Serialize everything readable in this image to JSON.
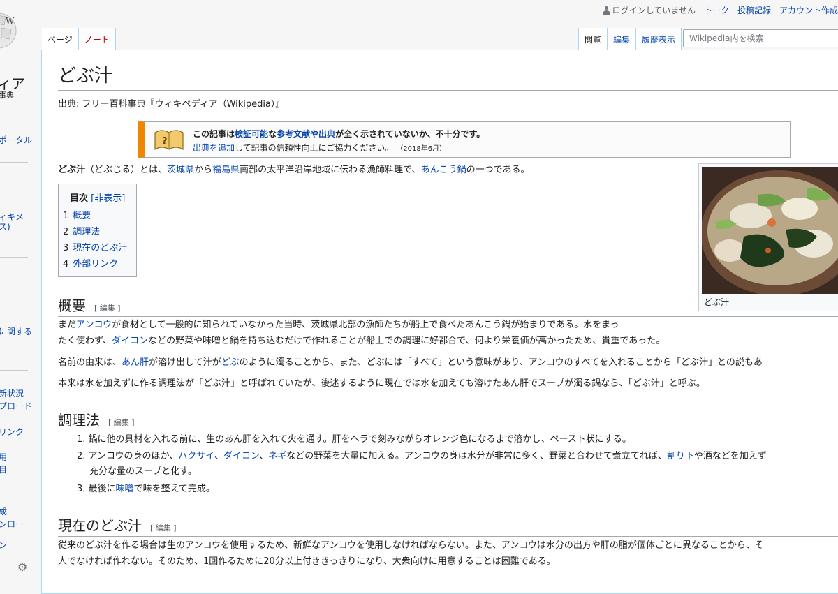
{
  "sidebar": {
    "logo_text": "ィア",
    "logo_sub": "事典",
    "links": [
      "ポータル",
      "ィキメ",
      "ス)",
      "に関する",
      "新状況",
      "プロード",
      "リンク",
      "用",
      "目",
      "成",
      "ンロー",
      "ン"
    ]
  },
  "header": {
    "user_status": "ログインしていません",
    "talk": "トーク",
    "contributions": "投稿記録",
    "create_account": "アカウント作成"
  },
  "tabs": {
    "page": "ページ",
    "notes": "ノート",
    "read": "閲覧",
    "edit": "編集",
    "history": "履歴表示"
  },
  "search": {
    "placeholder": "Wikipedia内を検索"
  },
  "article": {
    "title": "どぶ汁",
    "site_sub": "出典: フリー百科事典『ウィキペディア（Wikipedia）』",
    "ambox": {
      "line1_a": "この記事は",
      "line1_link1": "検証可能",
      "line1_b": "な",
      "line1_link2": "参考文献や出典",
      "line1_c": "が全く示されていないか、不十分です。",
      "line2_link": "出典を追加",
      "line2_text": "して記事の信頼性向上にご協力ください。",
      "date": "（2018年6月）"
    },
    "intro": {
      "bold": "どぶ汁",
      "t1": "（どぶじる）とは、",
      "l1": "茨城県",
      "t2": "から",
      "l2": "福島県",
      "t3": "南部の太平洋沿岸地域に伝わる漁師料理で、",
      "l3": "あんこう鍋",
      "t4": "の一つである。"
    },
    "toc": {
      "title": "目次",
      "toggle": "[非表示]",
      "items": [
        {
          "num": "1",
          "label": "概要"
        },
        {
          "num": "2",
          "label": "調理法"
        },
        {
          "num": "3",
          "label": "現在のどぶ汁"
        },
        {
          "num": "4",
          "label": "外部リンク"
        }
      ]
    },
    "thumb_caption": "どぶ汁",
    "edit_label": "[ 編集 ]",
    "sections": {
      "overview": {
        "title": "概要",
        "p1_a": "まだ",
        "p1_l1": "アンコウ",
        "p1_b": "が食材として一般的に知られていなかった当時、茨城県北部の漁師たちが船上で食べたあんこう鍋が始まりである。水をまっ",
        "p1_c": "たく使わず、",
        "p1_l2": "ダイコン",
        "p1_d": "などの野菜や味噌と鍋を持ち込むだけで作れることが船上での調理に好都合で、何より栄養価が高かったため、貴重であった。",
        "p2_a": "名前の由来は、",
        "p2_l1": "あん肝",
        "p2_b": "が溶け出して汁が",
        "p2_l2": "どぶ",
        "p2_c": "のように濁ることから、また、どぶには「すべて」という意味があり、アンコウのすべてを入れることから「どぶ汁」との説もあ",
        "p3": "本来は水を加えずに作る調理法が「どぶ汁」と呼ばれていたが、後述するように現在では水を加えても溶けたあん肝でスープが濁る鍋なら、「どぶ汁」と呼ぶ。"
      },
      "cooking": {
        "title": "調理法",
        "s1": "1. 鍋に他の具材を入れる前に、生のあん肝を入れて火を通す。肝をヘラで刻みながらオレンジ色になるまで溶かし、ペースト状にする。",
        "s2_a": "2. アンコウの身のほか、",
        "s2_l1": "ハクサイ",
        "s2_b": "、",
        "s2_l2": "ダイコン",
        "s2_c": "、",
        "s2_l3": "ネギ",
        "s2_d": "などの野菜を大量に加える。アンコウの身は水分が非常に多く、野菜と合わせて煮立てれば、",
        "s2_l4": "割り下",
        "s2_e": "や酒などを加えず",
        "s2_f": "充分な量のスープと化す。",
        "s3_a": "3. 最後に",
        "s3_l1": "味噌",
        "s3_b": "で味を整えて完成。"
      },
      "current": {
        "title": "現在のどぶ汁",
        "p1": "従来のどぶ汁を作る場合は生のアンコウを使用するため、新鮮なアンコウを使用しなければならない。また、アンコウは水分の出方や肝の脂が個体ごとに異なることから、そ",
        "p2": "人でなければ作れない。そのため、1回作るために20分以上付ききっきりになり、大衆向けに用意することは困難である。"
      }
    }
  }
}
